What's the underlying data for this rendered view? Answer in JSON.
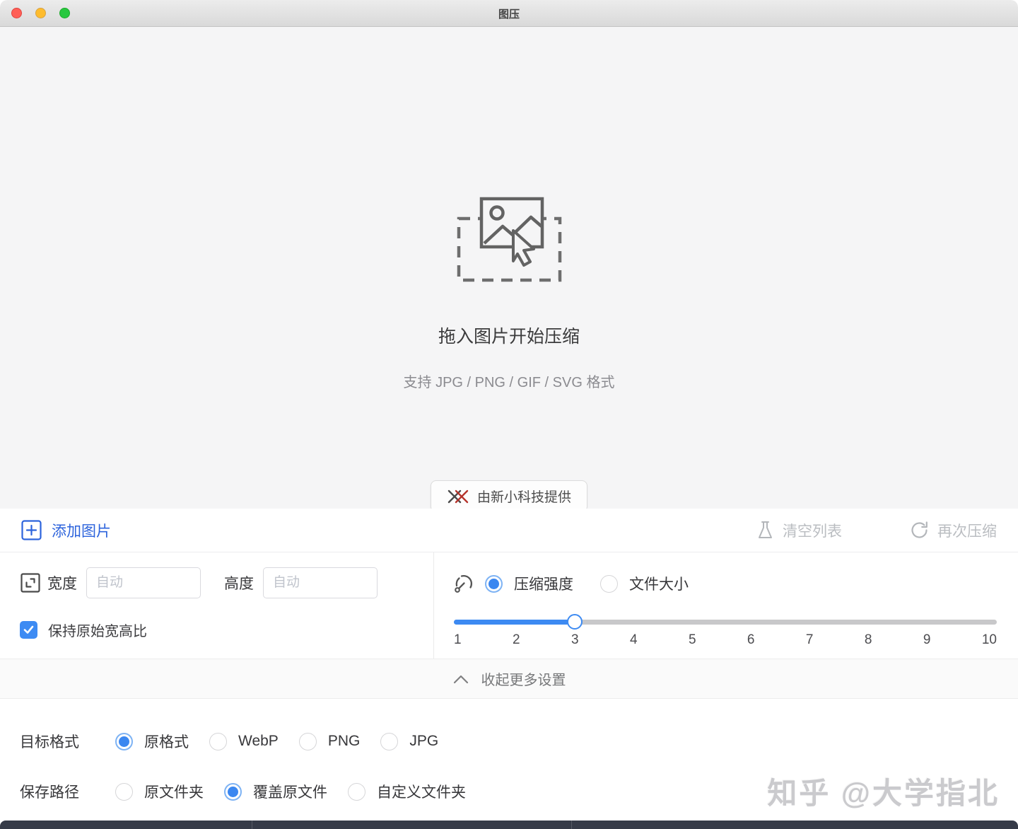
{
  "window": {
    "title": "图压"
  },
  "colors": {
    "accent_blue": "#2c63dc",
    "control_blue": "#3b87f0",
    "disabled_gray": "#babdc1",
    "logo_red": "#b5342c",
    "dropzone_bg": "#f5f5f6",
    "dark_bar": "#363b48"
  },
  "icons": {
    "drop_target": "image-with-cursor-icon",
    "provider_logo": "double-x-logo-icon",
    "add": "plus-square-icon",
    "clear": "flask-icon",
    "again": "refresh-icon",
    "resize": "resize-corners-icon",
    "strength": "gauge-icon",
    "collapse": "chevron-up-icon"
  },
  "dropzone": {
    "title": "拖入图片开始压缩",
    "subtitle": "支持 JPG / PNG / GIF / SVG 格式",
    "provider_button": "由新小科技提供"
  },
  "toolbar": {
    "add_images": "添加图片",
    "clear_list": "清空列表",
    "compress_again": "再次压缩"
  },
  "size_panel": {
    "width_label": "宽度",
    "width_placeholder": "自动",
    "width_value": "",
    "height_label": "高度",
    "height_placeholder": "自动",
    "height_value": "",
    "keep_ratio_label": "保持原始宽高比",
    "keep_ratio_checked": true
  },
  "compression_panel": {
    "mode_options": [
      {
        "label": "压缩强度",
        "selected": true
      },
      {
        "label": "文件大小",
        "selected": false
      }
    ],
    "slider": {
      "min": 1,
      "max": 10,
      "value": 3,
      "ticks": [
        "1",
        "2",
        "3",
        "4",
        "5",
        "6",
        "7",
        "8",
        "9",
        "10"
      ]
    }
  },
  "collapse_bar": {
    "label": "收起更多设置"
  },
  "format_row": {
    "label": "目标格式",
    "options": [
      {
        "label": "原格式",
        "selected": true
      },
      {
        "label": "WebP",
        "selected": false
      },
      {
        "label": "PNG",
        "selected": false
      },
      {
        "label": "JPG",
        "selected": false
      }
    ]
  },
  "path_row": {
    "label": "保存路径",
    "options": [
      {
        "label": "原文件夹",
        "selected": false
      },
      {
        "label": "覆盖原文件",
        "selected": true
      },
      {
        "label": "自定义文件夹",
        "selected": false
      }
    ]
  },
  "watermark": "知乎 @大学指北"
}
